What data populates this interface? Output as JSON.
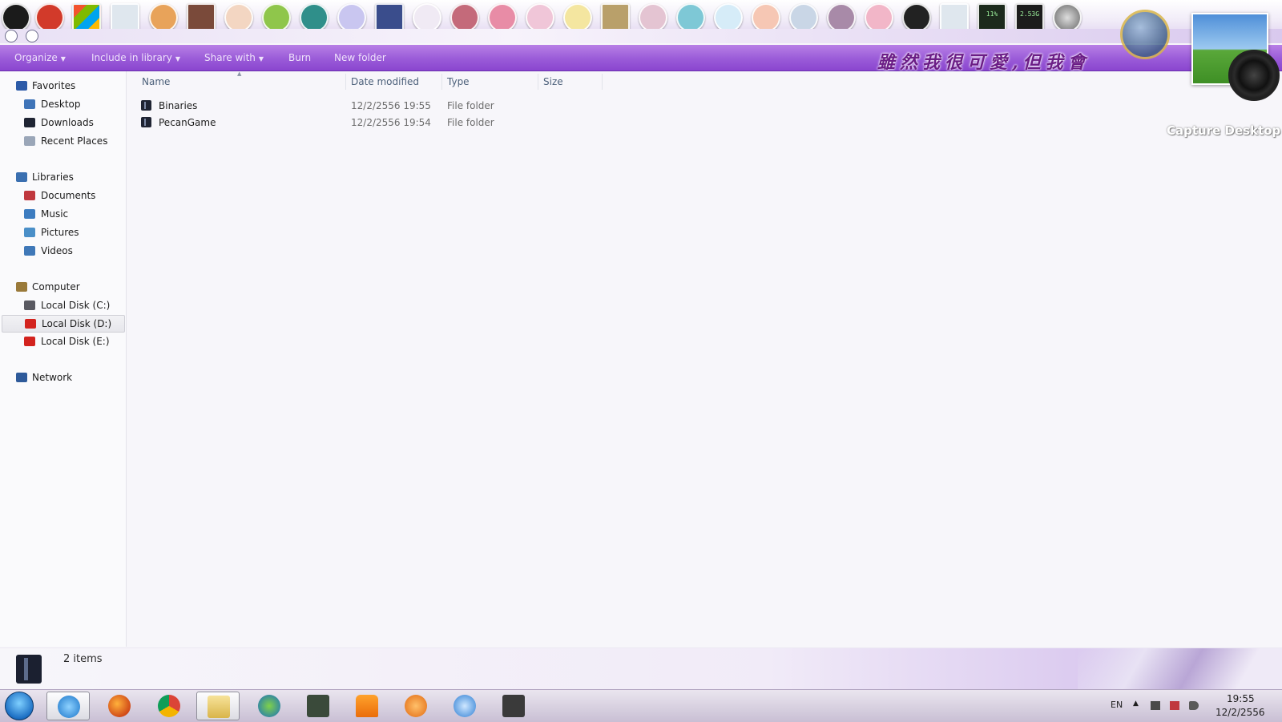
{
  "toolbar": {
    "organize": "Organize",
    "include_in_library": "Include in library",
    "share_with": "Share with",
    "burn": "Burn",
    "new_folder": "New folder",
    "banner_text": "雖然我很可愛,但我會"
  },
  "dock": {
    "cpu_meter": "11%",
    "mem_meter": "2.53G"
  },
  "nav": {
    "favorites": {
      "label": "Favorites",
      "items": [
        "Desktop",
        "Downloads",
        "Recent Places"
      ]
    },
    "libraries": {
      "label": "Libraries",
      "items": [
        "Documents",
        "Music",
        "Pictures",
        "Videos"
      ]
    },
    "computer": {
      "label": "Computer",
      "items": [
        "Local Disk (C:)",
        "Local Disk (D:)",
        "Local Disk (E:)"
      ],
      "selected": "Local Disk (D:)"
    },
    "network": {
      "label": "Network"
    }
  },
  "columns": {
    "name": "Name",
    "date_modified": "Date modified",
    "type": "Type",
    "size": "Size"
  },
  "files": [
    {
      "name": "Binaries",
      "date": "12/2/2556 19:55",
      "type": "File folder"
    },
    {
      "name": "PecanGame",
      "date": "12/2/2556 19:54",
      "type": "File folder"
    }
  ],
  "gadget": {
    "label": "Capture Desktop"
  },
  "status": {
    "count": "2 items"
  },
  "tray": {
    "language": "EN",
    "time": "19:55",
    "date": "12/2/2556"
  },
  "colors": {
    "accent": "#9a5bd8",
    "selection": "#e6e6eb"
  }
}
